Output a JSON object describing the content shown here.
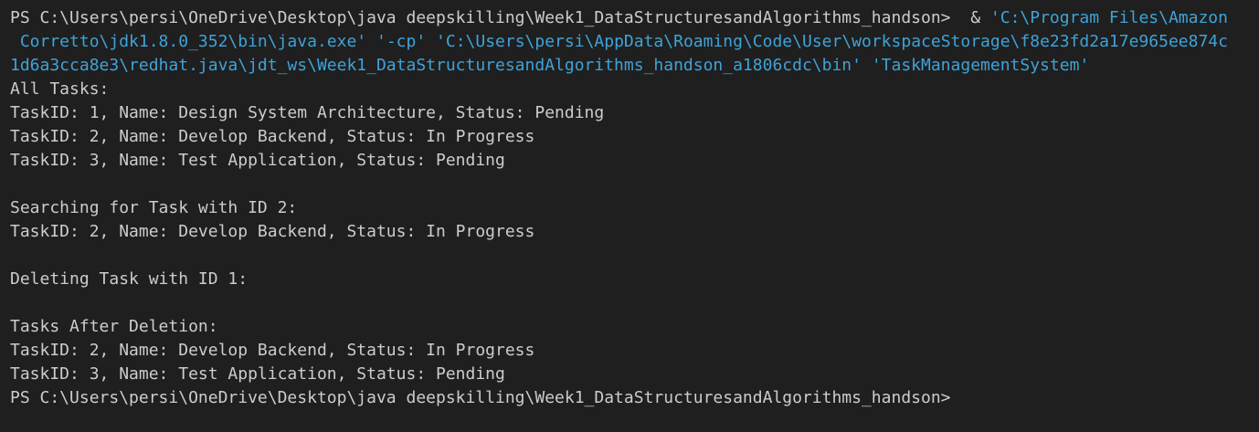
{
  "terminal": {
    "command": {
      "prompt": "PS C:\\Users\\persi\\OneDrive\\Desktop\\java deepskilling\\Week1_DataStructuresandAlgorithms_handson>",
      "operator": "&",
      "arg_java_line1": "'C:\\Program Files\\Amazon",
      "arg_java_line2": " Corretto\\jdk1.8.0_352\\bin\\java.exe'",
      "arg_cp": "'-cp'",
      "arg_classpath_line2": "'C:\\Users\\persi\\AppData\\Roaming\\Code\\User\\workspaceStorage\\f8e23fd2a17e965ee874c",
      "arg_classpath_line3": "1d6a3cca8e3\\redhat.java\\jdt_ws\\Week1_DataStructuresandAlgorithms_handson_a1806cdc\\bin'",
      "arg_main_class": "'TaskManagementSystem'"
    },
    "output": {
      "all_tasks_heading": "All Tasks:",
      "all_tasks": [
        "TaskID: 1, Name: Design System Architecture, Status: Pending",
        "TaskID: 2, Name: Develop Backend, Status: In Progress",
        "TaskID: 3, Name: Test Application, Status: Pending"
      ],
      "search_heading": "Searching for Task with ID 2:",
      "search_result": "TaskID: 2, Name: Develop Backend, Status: In Progress",
      "delete_heading": "Deleting Task with ID 1:",
      "after_delete_heading": "Tasks After Deletion:",
      "after_delete_tasks": [
        "TaskID: 2, Name: Develop Backend, Status: In Progress",
        "TaskID: 3, Name: Test Application, Status: Pending"
      ]
    },
    "final_prompt": "PS C:\\Users\\persi\\OneDrive\\Desktop\\java deepskilling\\Week1_DataStructuresandAlgorithms_handson>",
    "colors": {
      "background": "#1f1f1f",
      "text": "#cccccc",
      "string_argument": "#3ea3d9"
    }
  }
}
